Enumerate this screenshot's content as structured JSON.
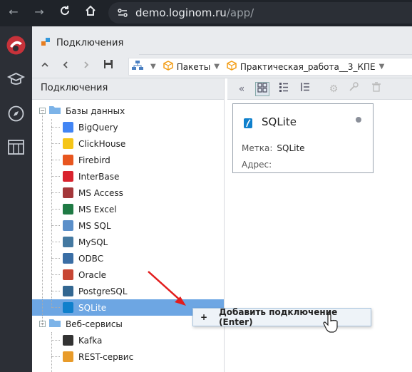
{
  "browser": {
    "url_host": "demo.loginom.ru",
    "url_path": "/app/"
  },
  "tab": {
    "label": "Подключения"
  },
  "breadcrumbs": [
    {
      "label": "Пакеты"
    },
    {
      "label": "Практическая_работа__3_КПЕ"
    }
  ],
  "left_panel": {
    "title": "Подключения",
    "groups": [
      {
        "label": "Базы данных",
        "items": [
          {
            "label": "BigQuery",
            "icon": "bigquery-icon",
            "color": "#4285f4"
          },
          {
            "label": "ClickHouse",
            "icon": "clickhouse-icon",
            "color": "#f5c518"
          },
          {
            "label": "Firebird",
            "icon": "firebird-icon",
            "color": "#e8561f"
          },
          {
            "label": "InterBase",
            "icon": "interbase-icon",
            "color": "#d9232e"
          },
          {
            "label": "MS Access",
            "icon": "msaccess-icon",
            "color": "#a4373a"
          },
          {
            "label": "MS Excel",
            "icon": "msexcel-icon",
            "color": "#1f7a44"
          },
          {
            "label": "MS SQL",
            "icon": "mssql-icon",
            "color": "#5b8fc9"
          },
          {
            "label": "MySQL",
            "icon": "mysql-icon",
            "color": "#4479a1"
          },
          {
            "label": "ODBC",
            "icon": "odbc-icon",
            "color": "#3a6ea5"
          },
          {
            "label": "Oracle",
            "icon": "oracle-icon",
            "color": "#c74634"
          },
          {
            "label": "PostgreSQL",
            "icon": "postgresql-icon",
            "color": "#336791"
          },
          {
            "label": "SQLite",
            "icon": "sqlite-icon",
            "color": "#0f80cc",
            "selected": true
          }
        ]
      },
      {
        "label": "Веб-сервисы",
        "items": [
          {
            "label": "Kafka",
            "icon": "kafka-icon",
            "color": "#333333"
          },
          {
            "label": "REST-сервис",
            "icon": "rest-icon",
            "color": "#e89b2a"
          }
        ]
      }
    ]
  },
  "card": {
    "title": "SQLite",
    "label_key": "Метка:",
    "label_value": "SQLite",
    "address_key": "Адрес:",
    "address_value": ""
  },
  "context_menu": {
    "item_label": "Добавить подключение (Enter)"
  },
  "colors": {
    "selection": "#6da6e3",
    "accent": "#f39c12",
    "dark_chrome": "#2c2f36"
  }
}
